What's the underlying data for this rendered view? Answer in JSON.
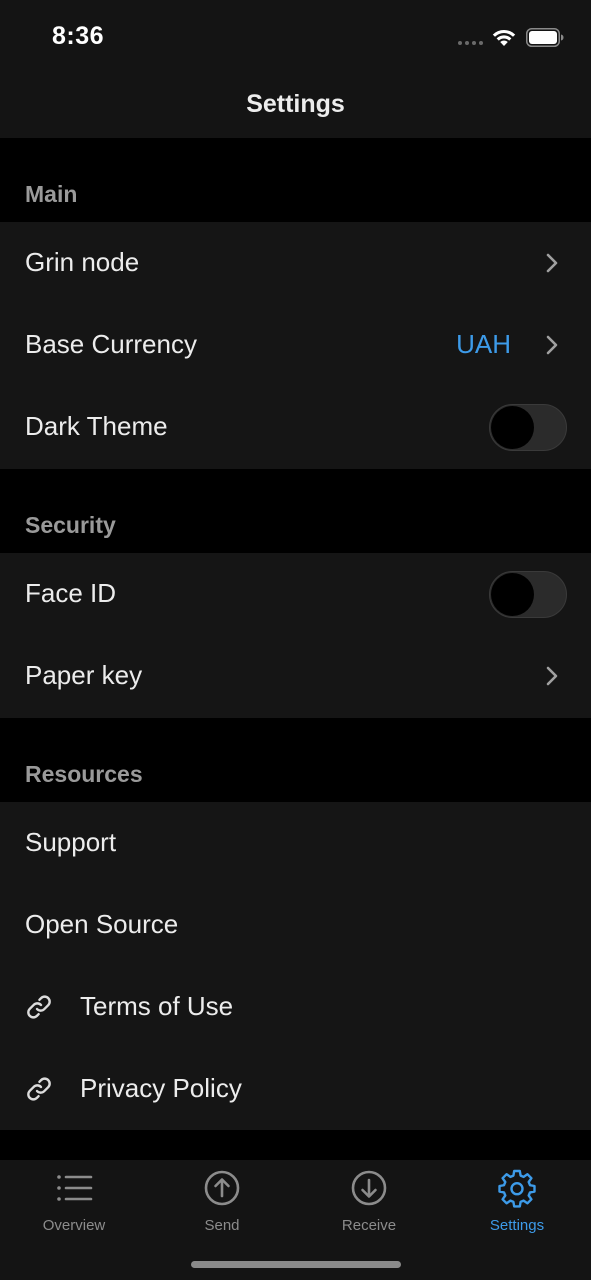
{
  "status_bar": {
    "time": "8:36"
  },
  "nav": {
    "title": "Settings"
  },
  "sections": {
    "main": {
      "header": "Main",
      "grin_node": "Grin node",
      "base_currency": "Base Currency",
      "base_currency_value": "UAH",
      "dark_theme": "Dark Theme",
      "dark_theme_on": false
    },
    "security": {
      "header": "Security",
      "face_id": "Face ID",
      "face_id_on": false,
      "paper_key": "Paper key"
    },
    "resources": {
      "header": "Resources",
      "support": "Support",
      "open_source": "Open Source",
      "terms_of_use": "Terms of Use",
      "privacy_policy": "Privacy Policy"
    }
  },
  "tabs": [
    {
      "label": "Overview",
      "icon": "list-icon",
      "active": false
    },
    {
      "label": "Send",
      "icon": "arrow-up-circle-icon",
      "active": false
    },
    {
      "label": "Receive",
      "icon": "arrow-down-circle-icon",
      "active": false
    },
    {
      "label": "Settings",
      "icon": "gear-icon",
      "active": true
    }
  ],
  "colors": {
    "accent": "#3d9be9",
    "background": "#000000",
    "surface": "#151515",
    "secondary_text": "#9a9a9a"
  }
}
